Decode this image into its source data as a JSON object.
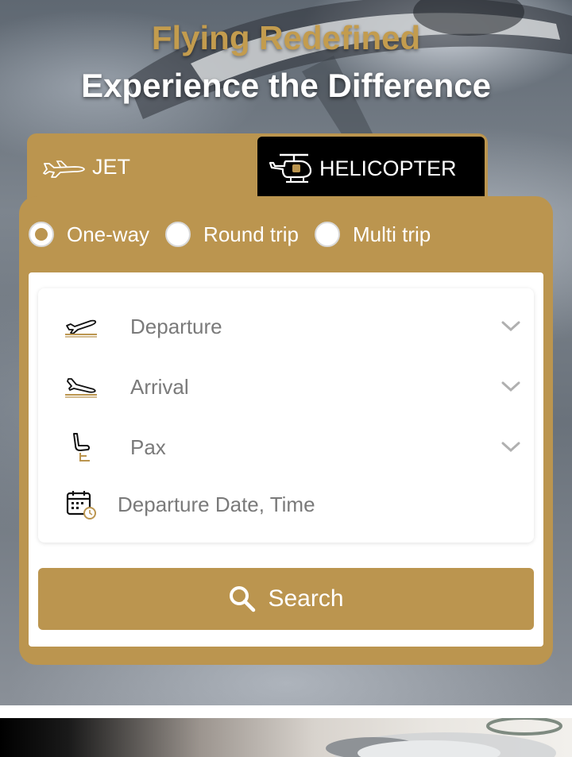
{
  "hero": {
    "title": "Flying Redefined",
    "subtitle": "Experience the Difference"
  },
  "tabs": [
    {
      "label": "JET",
      "icon": "jet-icon",
      "active": false
    },
    {
      "label": "HELICOPTER",
      "icon": "helicopter-icon",
      "active": true
    }
  ],
  "trip_type": {
    "options": [
      "One-way",
      "Round trip",
      "Multi trip"
    ],
    "selected": "One-way"
  },
  "form": {
    "departure_placeholder": "Departure",
    "arrival_placeholder": "Arrival",
    "pax_placeholder": "Pax",
    "date_placeholder": "Departure Date, Time"
  },
  "search": {
    "label": "Search",
    "icon": "search-icon"
  },
  "colors": {
    "brand_gold": "#bb954f",
    "title_gold": "#c39c4e",
    "active_tab": "#000000"
  }
}
